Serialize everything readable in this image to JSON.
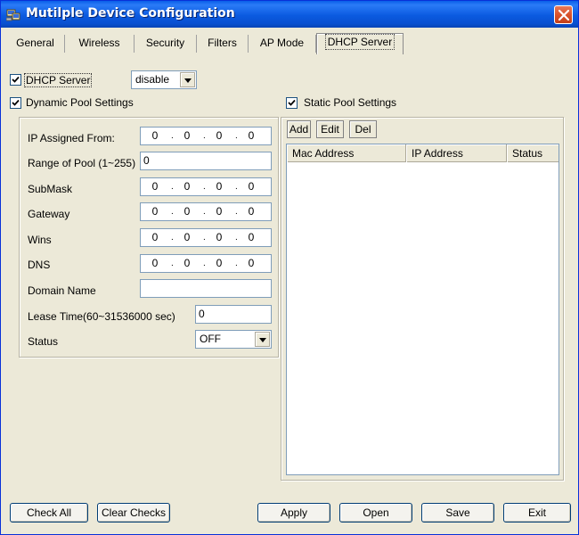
{
  "window": {
    "title": "Mutilple Device Configuration"
  },
  "tabs": [
    {
      "label": "General"
    },
    {
      "label": "Wireless"
    },
    {
      "label": "Security"
    },
    {
      "label": "Filters"
    },
    {
      "label": "AP Mode"
    },
    {
      "label": "DHCP Server",
      "active": true
    }
  ],
  "dhcp": {
    "server_label": "DHCP Server",
    "server_checked": true,
    "server_mode": "disable"
  },
  "dynamic": {
    "label": "Dynamic Pool Settings",
    "checked": true,
    "ip_assigned_from": {
      "label": "IP Assigned From:",
      "octets": [
        "0",
        "0",
        "0",
        "0"
      ]
    },
    "range_of_pool": {
      "label": "Range of Pool (1~255)",
      "value": "0"
    },
    "submask": {
      "label": "SubMask",
      "octets": [
        "0",
        "0",
        "0",
        "0"
      ]
    },
    "gateway": {
      "label": "Gateway",
      "octets": [
        "0",
        "0",
        "0",
        "0"
      ]
    },
    "wins": {
      "label": "Wins",
      "octets": [
        "0",
        "0",
        "0",
        "0"
      ]
    },
    "dns": {
      "label": "DNS",
      "octets": [
        "0",
        "0",
        "0",
        "0"
      ]
    },
    "domain_name": {
      "label": "Domain Name",
      "value": ""
    },
    "lease_time": {
      "label": "Lease Time(60~31536000 sec)",
      "value": "0"
    },
    "status": {
      "label": "Status",
      "value": "OFF"
    }
  },
  "static": {
    "label": "Static Pool Settings",
    "checked": true,
    "add_label": "Add",
    "edit_label": "Edit",
    "del_label": "Del",
    "columns": [
      "Mac Address",
      "IP Address",
      "Status"
    ],
    "rows": []
  },
  "footer": {
    "check_all": "Check All",
    "clear_checks": "Clear Checks",
    "apply": "Apply",
    "open": "Open",
    "save": "Save",
    "exit": "Exit"
  },
  "colors": {
    "titlebar": "#0a5ee8",
    "window_bg": "#ece9d8",
    "close_button": "#d9532c"
  }
}
